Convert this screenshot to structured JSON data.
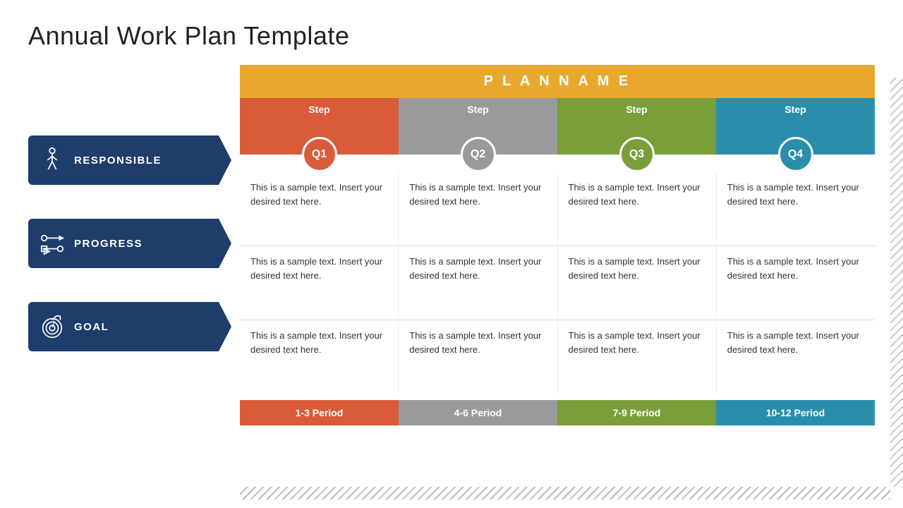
{
  "title": "Annual Work Plan Template",
  "plan_name": "P L A N   N A M E",
  "steps": [
    {
      "label": "Step",
      "quarter": "Q1",
      "color_class": "step-col-1",
      "circle_class": "circle-1"
    },
    {
      "label": "Step",
      "quarter": "Q2",
      "color_class": "step-col-2",
      "circle_class": "circle-2"
    },
    {
      "label": "Step",
      "quarter": "Q3",
      "color_class": "step-col-3",
      "circle_class": "circle-3"
    },
    {
      "label": "Step",
      "quarter": "Q4",
      "color_class": "step-col-4",
      "circle_class": "circle-4"
    }
  ],
  "rows": [
    {
      "label": "RESPONSIBLE",
      "cells": [
        "This is a sample text. Insert your desired text here.",
        "This is a sample text. Insert your desired text here.",
        "This is a sample text. Insert your desired text here.",
        "This is a sample text. Insert your desired text here."
      ]
    },
    {
      "label": "PROGRESS",
      "cells": [
        "This is a sample text. Insert your desired text here.",
        "This is a sample text. Insert your desired text here.",
        "This is a sample text. Insert your desired text here.",
        "This is a sample text. Insert your desired text here."
      ]
    },
    {
      "label": "GOAL",
      "cells": [
        "This is a sample text. Insert your desired text here.",
        "This is a sample text. Insert your desired text here.",
        "This is a sample text. Insert your desired text here.",
        "This is a sample text. Insert your desired text here."
      ]
    }
  ],
  "periods": [
    {
      "label": "1-3 Period",
      "color_class": "period-1"
    },
    {
      "label": "4-6 Period",
      "color_class": "period-2"
    },
    {
      "label": "7-9 Period",
      "color_class": "period-3"
    },
    {
      "label": "10-12 Period",
      "color_class": "period-4"
    }
  ]
}
